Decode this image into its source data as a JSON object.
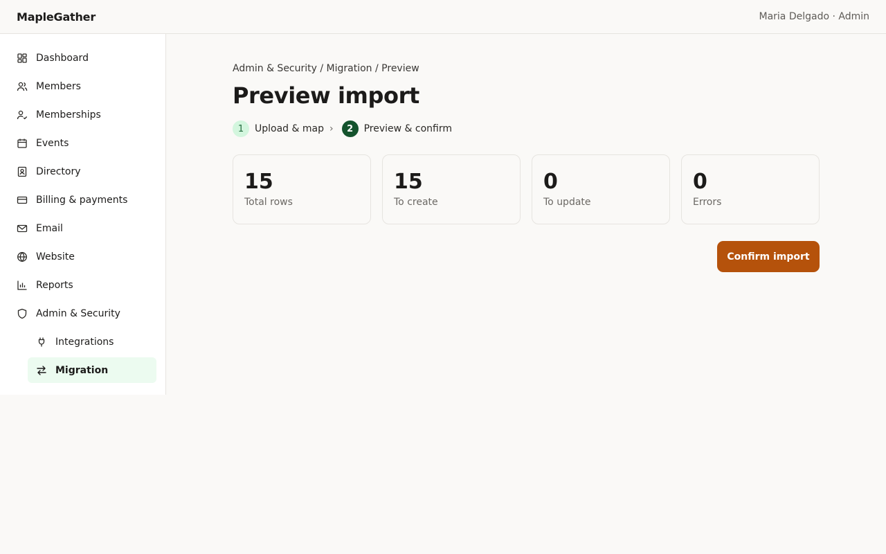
{
  "app": {
    "brand": "MapleGather",
    "user": "Maria Delgado · Admin"
  },
  "sidebar": {
    "items": [
      {
        "label": "Dashboard",
        "icon": "dashboard-icon"
      },
      {
        "label": "Members",
        "icon": "members-icon"
      },
      {
        "label": "Memberships",
        "icon": "memberships-icon"
      },
      {
        "label": "Events",
        "icon": "calendar-icon"
      },
      {
        "label": "Directory",
        "icon": "directory-icon"
      },
      {
        "label": "Billing & payments",
        "icon": "credit-card-icon"
      },
      {
        "label": "Email",
        "icon": "mail-icon"
      },
      {
        "label": "Website",
        "icon": "globe-icon"
      },
      {
        "label": "Reports",
        "icon": "bar-chart-icon"
      },
      {
        "label": "Admin & Security",
        "icon": "shield-icon"
      }
    ],
    "subitems": [
      {
        "label": "Integrations",
        "icon": "plug-icon"
      },
      {
        "label": "Migration",
        "icon": "swap-arrows-icon",
        "active": true
      }
    ]
  },
  "page": {
    "breadcrumb": "Admin & Security / Migration / Preview",
    "title": "Preview import",
    "steps": [
      {
        "num": "1",
        "label": "Upload & map"
      },
      {
        "num": "2",
        "label": "Preview & confirm"
      }
    ],
    "step_separator": "›",
    "stats": [
      {
        "value": "15",
        "label": "Total rows"
      },
      {
        "value": "15",
        "label": "To create"
      },
      {
        "value": "0",
        "label": "To update"
      },
      {
        "value": "0",
        "label": "Errors"
      }
    ],
    "confirm_label": "Confirm import"
  },
  "colors": {
    "accent": "#b5520b",
    "active_bg": "#ecfbf0",
    "step_current": "#14532d",
    "step_done_bg": "#d3f6de"
  }
}
